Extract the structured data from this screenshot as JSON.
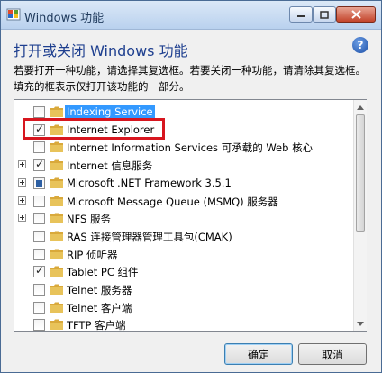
{
  "window": {
    "title": "Windows 功能",
    "controls": {
      "minimize": "—",
      "maximize": "□",
      "close": "✕"
    }
  },
  "header": {
    "heading": "打开或关闭 Windows 功能",
    "help_symbol": "?"
  },
  "description": "若要打开一种功能，请选择其复选框。若要关闭一种功能，请清除其复选框。填充的框表示仅打开该功能的一部分。",
  "features": [
    {
      "label": "Indexing Service",
      "state": "unchecked",
      "expandable": false,
      "selected": true
    },
    {
      "label": "Internet Explorer",
      "state": "checked",
      "expandable": false,
      "selected": false
    },
    {
      "label": "Internet Information Services 可承载的 Web 核心",
      "state": "unchecked",
      "expandable": false,
      "selected": false
    },
    {
      "label": "Internet 信息服务",
      "state": "checked",
      "expandable": true,
      "selected": false
    },
    {
      "label": "Microsoft .NET Framework 3.5.1",
      "state": "partial",
      "expandable": true,
      "selected": false
    },
    {
      "label": "Microsoft Message Queue (MSMQ) 服务器",
      "state": "unchecked",
      "expandable": true,
      "selected": false
    },
    {
      "label": "NFS 服务",
      "state": "unchecked",
      "expandable": true,
      "selected": false
    },
    {
      "label": "RAS 连接管理器管理工具包(CMAK)",
      "state": "unchecked",
      "expandable": false,
      "selected": false
    },
    {
      "label": "RIP 侦听器",
      "state": "unchecked",
      "expandable": false,
      "selected": false
    },
    {
      "label": "Tablet PC 组件",
      "state": "checked",
      "expandable": false,
      "selected": false
    },
    {
      "label": "Telnet 服务器",
      "state": "unchecked",
      "expandable": false,
      "selected": false
    },
    {
      "label": "Telnet 客户端",
      "state": "unchecked",
      "expandable": false,
      "selected": false
    },
    {
      "label": "TFTP 客户端",
      "state": "unchecked",
      "expandable": false,
      "selected": false
    }
  ],
  "buttons": {
    "ok": "确定",
    "cancel": "取消"
  },
  "colors": {
    "highlight_box": "#d7161f",
    "selection": "#3399ff",
    "folder": "#e8c35a"
  }
}
